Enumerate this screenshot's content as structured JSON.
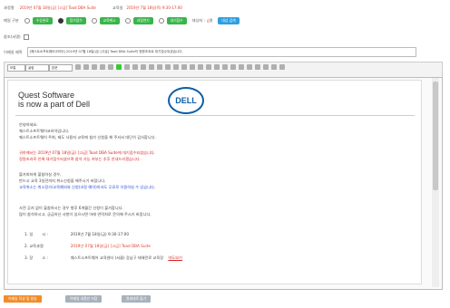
{
  "header": {
    "row1_label": "과정명",
    "row1_value": "2019년 07월 18일(금) [고급] Toad DBA Suite",
    "row1_label2": "교육일",
    "row1_value2": "2019년 7월 18일(목) 9:30-17:00",
    "row2_label": "메일 구분",
    "options": [
      "수강완료",
      "참가접수",
      "교육취소",
      "과정연기",
      "대기접수"
    ],
    "count_label": "대상자 :",
    "count_value": "0",
    "count_unit": "명",
    "search_button": "대상 검색",
    "row3_label": "참조(서명)",
    "row4_label": "이메일 제목",
    "subject": "[퀘스트소프트웨어코리아] 2019년 07월 18일(금) [고급] Toad DBA Suite의 정원초과로 대기접수되셨습니다."
  },
  "toolbar": {
    "style_select": "보통",
    "font_select": "굴림",
    "size_select": "본문"
  },
  "doc": {
    "brand_line1": "Quest Software",
    "brand_line2": "is now a part of Dell",
    "logo": "DELL",
    "greeting": "안녕하세요.",
    "intro": "퀘스트소프트웨어코리아입니다.",
    "thanks": "퀘스트소프트웨어 주최, 제도 사용자 교육에 참가 신청을 해 주셔서 대단히 감사합니다.",
    "notice1": "귀하께서는 2019년 07월 18일(금) [고급] Toad DBA Suite에 대기접수되셨습니다.",
    "notice2": "정원초과로 인해 대기접수되셨으며 참석 가능 여부는 추후 안내드리겠습니다.",
    "line1": "불가피하게 불참하실 경우,",
    "line2": "반드시 교육 3일전까지 취소신청을 해주시기 바랍니다.",
    "line3": "교육취소는 취소정가/교육예외와 신청(과정 예약)하셔도 무료로 이용하실 수 있습니다.",
    "line4": "사전 공지 없이 불참하시는 경우 향후 6개월간 신청이 불가합니다.",
    "line5": "많이 참석하시고, 궁금하신 사항이 있으시면 아래 연락처로 문의해 주시기 바랍니다.",
    "info": [
      {
        "num": "1. 일",
        "key": "시 :",
        "val": "2019년 7월 18일(금) 9:30-17:00"
      },
      {
        "num": "2. 교육과정",
        "key": ":",
        "val": "2019년 07월 18일(금) [고급] Toad DBA Suite"
      },
      {
        "num": "3. 장",
        "key": "소 :",
        "val": "퀘스트소프트웨어 교육센터 (서울) 강남구 테헤란로 교육장",
        "link": "약도보기"
      }
    ]
  },
  "footer": {
    "btn1": "이메일 작성 및 발송",
    "btn2": "이메일 내용만 저장",
    "btn3": "원래대로 돌기"
  }
}
